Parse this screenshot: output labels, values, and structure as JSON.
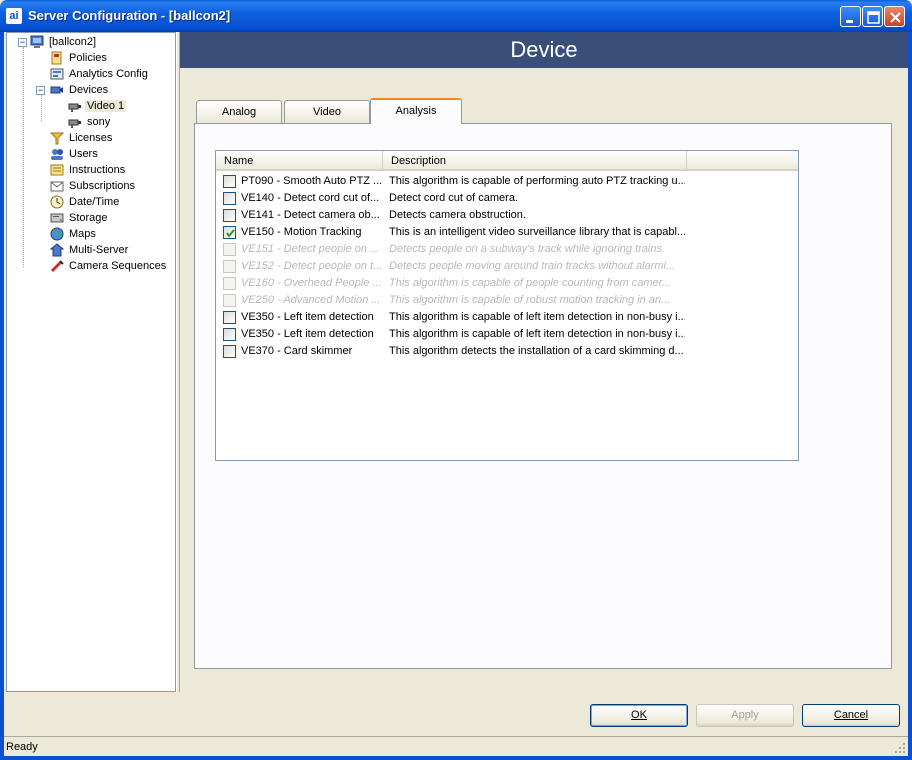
{
  "window": {
    "title": "Server Configuration - [ballcon2]",
    "app_icon_text": "ai"
  },
  "tree": {
    "root": "[ballcon2]",
    "items": [
      {
        "label": "Policies",
        "icon": "policy-icon"
      },
      {
        "label": "Analytics Config",
        "icon": "analytics-icon"
      },
      {
        "label": "Devices",
        "icon": "devices-icon"
      },
      {
        "label": "Video 1",
        "icon": "camera-icon",
        "selected": true
      },
      {
        "label": "sony",
        "icon": "camera-icon"
      },
      {
        "label": "Licenses",
        "icon": "license-icon"
      },
      {
        "label": "Users",
        "icon": "users-icon"
      },
      {
        "label": "Instructions",
        "icon": "instructions-icon"
      },
      {
        "label": "Subscriptions",
        "icon": "subscriptions-icon"
      },
      {
        "label": "Date/Time",
        "icon": "clock-icon"
      },
      {
        "label": "Storage",
        "icon": "storage-icon"
      },
      {
        "label": "Maps",
        "icon": "globe-icon"
      },
      {
        "label": "Multi-Server",
        "icon": "network-icon"
      },
      {
        "label": "Camera Sequences",
        "icon": "sequence-icon"
      }
    ]
  },
  "header": {
    "title": "Device"
  },
  "tabs": [
    {
      "label": "Analog"
    },
    {
      "label": "Video"
    },
    {
      "label": "Analysis",
      "active": true
    }
  ],
  "list": {
    "columns": [
      "Name",
      "Description"
    ],
    "rows": [
      {
        "name": "PT090 - Smooth Auto PTZ ...",
        "desc": "This algorithm is capable of performing auto PTZ tracking u...",
        "checked": false,
        "enabled": true
      },
      {
        "name": "VE140 - Detect cord cut of...",
        "desc": "Detect cord cut of camera.",
        "checked": false,
        "enabled": true
      },
      {
        "name": "VE141 - Detect camera ob...",
        "desc": "Detects camera obstruction.",
        "checked": false,
        "enabled": true
      },
      {
        "name": "VE150 - Motion Tracking",
        "desc": "This is an intelligent video surveillance library that is capabl...",
        "checked": true,
        "enabled": true
      },
      {
        "name": "VE151 - Detect people on ...",
        "desc": "Detects people on a subway's track while ignoring trains.",
        "checked": false,
        "enabled": false
      },
      {
        "name": "VE152 - Detect people on t...",
        "desc": "Detects people moving around train tracks without alarmi...",
        "checked": false,
        "enabled": false
      },
      {
        "name": "VE160 - Overhead People ...",
        "desc": "This algorithm is capable of people counting from camer...",
        "checked": false,
        "enabled": false
      },
      {
        "name": "VE250 - Advanced Motion ...",
        "desc": "This algorithm is capable of robust motion tracking in an...",
        "checked": false,
        "enabled": false
      },
      {
        "name": "VE350 - Left item detection",
        "desc": "This algorithm is capable of left item detection in non-busy i...",
        "checked": false,
        "enabled": true
      },
      {
        "name": "VE350 - Left item detection",
        "desc": "This algorithm is capable of left item detection in non-busy i...",
        "checked": false,
        "enabled": true
      },
      {
        "name": "VE370 - Card skimmer",
        "desc": "This algorithm detects the installation of a card skimming d...",
        "checked": false,
        "enabled": true
      }
    ]
  },
  "buttons": {
    "ok": "OK",
    "apply": "Apply",
    "cancel": "Cancel"
  },
  "status": {
    "text": "Ready"
  },
  "colors": {
    "titlebar": "#0a50d0",
    "header_bg": "#3a4e7a",
    "active_tab_accent": "#e68b2c"
  }
}
